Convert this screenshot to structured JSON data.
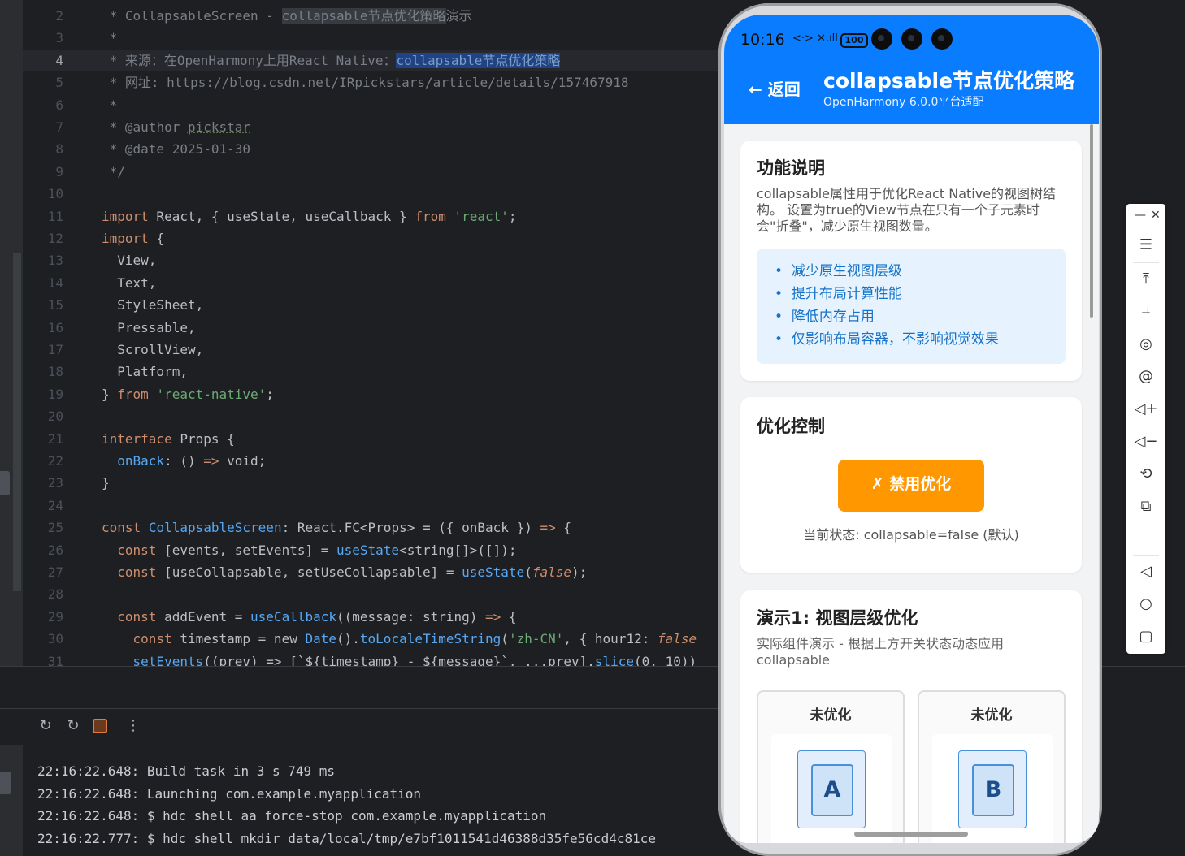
{
  "editor": {
    "lines": [
      {
        "n": "2",
        "parts": [
          {
            "t": " * CollapsableScreen - ",
            "c": "c-com"
          },
          {
            "t": "collapsable节点优化策略",
            "c": "c-hl2"
          },
          {
            "t": "演示",
            "c": "c-com"
          }
        ]
      },
      {
        "n": "3",
        "parts": [
          {
            "t": " *",
            "c": "c-com"
          }
        ]
      },
      {
        "n": "4",
        "current": true,
        "parts": [
          {
            "t": " * 来源：在OpenHarmony上用React Native：",
            "c": "c-com"
          },
          {
            "t": "collapsable节点优化策略",
            "c": "c-hl"
          }
        ]
      },
      {
        "n": "5",
        "parts": [
          {
            "t": " * 网址: https://blog.csdn.net/IRpickstars/article/details/157467918",
            "c": "c-com"
          }
        ]
      },
      {
        "n": "6",
        "parts": [
          {
            "t": " *",
            "c": "c-com"
          }
        ]
      },
      {
        "n": "7",
        "parts": [
          {
            "t": " * ",
            "c": "c-com"
          },
          {
            "t": "@author",
            "c": "c-com"
          },
          {
            "t": " ",
            "c": "c-com"
          },
          {
            "t": "pickstar",
            "c": "c-com c-under"
          }
        ]
      },
      {
        "n": "8",
        "parts": [
          {
            "t": " * @date 2025-01-30",
            "c": "c-com"
          }
        ]
      },
      {
        "n": "9",
        "parts": [
          {
            "t": " */",
            "c": "c-com"
          }
        ]
      },
      {
        "n": "10",
        "parts": []
      },
      {
        "n": "11",
        "parts": [
          {
            "t": "import",
            "c": "c-kw"
          },
          {
            "t": " React, { useState, useCallback } ",
            "c": ""
          },
          {
            "t": "from",
            "c": "c-kw"
          },
          {
            "t": " ",
            "c": ""
          },
          {
            "t": "'react'",
            "c": "c-str"
          },
          {
            "t": ";",
            "c": ""
          }
        ]
      },
      {
        "n": "12",
        "parts": [
          {
            "t": "import",
            "c": "c-kw"
          },
          {
            "t": " {",
            "c": ""
          }
        ]
      },
      {
        "n": "13",
        "parts": [
          {
            "t": "  View,",
            "c": ""
          }
        ]
      },
      {
        "n": "14",
        "parts": [
          {
            "t": "  Text,",
            "c": ""
          }
        ]
      },
      {
        "n": "15",
        "parts": [
          {
            "t": "  StyleSheet,",
            "c": ""
          }
        ]
      },
      {
        "n": "16",
        "parts": [
          {
            "t": "  Pressable,",
            "c": ""
          }
        ]
      },
      {
        "n": "17",
        "parts": [
          {
            "t": "  ScrollView,",
            "c": ""
          }
        ]
      },
      {
        "n": "18",
        "parts": [
          {
            "t": "  Platform,",
            "c": ""
          }
        ]
      },
      {
        "n": "19",
        "parts": [
          {
            "t": "} ",
            "c": ""
          },
          {
            "t": "from",
            "c": "c-kw"
          },
          {
            "t": " ",
            "c": ""
          },
          {
            "t": "'react-native'",
            "c": "c-str"
          },
          {
            "t": ";",
            "c": ""
          }
        ]
      },
      {
        "n": "20",
        "parts": []
      },
      {
        "n": "21",
        "parts": [
          {
            "t": "interface",
            "c": "c-kw"
          },
          {
            "t": " Props {",
            "c": ""
          }
        ]
      },
      {
        "n": "22",
        "parts": [
          {
            "t": "  ",
            "c": ""
          },
          {
            "t": "onBack",
            "c": "c-fn"
          },
          {
            "t": ": () ",
            "c": ""
          },
          {
            "t": "=>",
            "c": "c-kw"
          },
          {
            "t": " void;",
            "c": ""
          }
        ]
      },
      {
        "n": "23",
        "parts": [
          {
            "t": "}",
            "c": ""
          }
        ]
      },
      {
        "n": "24",
        "parts": []
      },
      {
        "n": "25",
        "parts": [
          {
            "t": "const",
            "c": "c-kw"
          },
          {
            "t": " ",
            "c": ""
          },
          {
            "t": "CollapsableScreen",
            "c": "c-fn"
          },
          {
            "t": ": React.FC<Props> = ({ onBack }) ",
            "c": ""
          },
          {
            "t": "=>",
            "c": "c-kw"
          },
          {
            "t": " {",
            "c": ""
          }
        ]
      },
      {
        "n": "26",
        "parts": [
          {
            "t": "  ",
            "c": ""
          },
          {
            "t": "const",
            "c": "c-kw"
          },
          {
            "t": " [events, setEvents] = ",
            "c": ""
          },
          {
            "t": "useState",
            "c": "c-fn"
          },
          {
            "t": "<string[]>([]);",
            "c": ""
          }
        ]
      },
      {
        "n": "27",
        "parts": [
          {
            "t": "  ",
            "c": ""
          },
          {
            "t": "const",
            "c": "c-kw"
          },
          {
            "t": " [useCollapsable, setUseCollapsable] = ",
            "c": ""
          },
          {
            "t": "useState",
            "c": "c-fn"
          },
          {
            "t": "(",
            "c": ""
          },
          {
            "t": "false",
            "c": "c-ital"
          },
          {
            "t": ");",
            "c": ""
          }
        ]
      },
      {
        "n": "28",
        "parts": []
      },
      {
        "n": "29",
        "parts": [
          {
            "t": "  ",
            "c": ""
          },
          {
            "t": "const",
            "c": "c-kw"
          },
          {
            "t": " addEvent = ",
            "c": ""
          },
          {
            "t": "useCallback",
            "c": "c-fn"
          },
          {
            "t": "((message: string) ",
            "c": ""
          },
          {
            "t": "=>",
            "c": "c-kw"
          },
          {
            "t": " {",
            "c": ""
          }
        ]
      },
      {
        "n": "30",
        "parts": [
          {
            "t": "    ",
            "c": ""
          },
          {
            "t": "const",
            "c": "c-kw"
          },
          {
            "t": " timestamp = new ",
            "c": ""
          },
          {
            "t": "Date",
            "c": "c-fn"
          },
          {
            "t": "().",
            "c": ""
          },
          {
            "t": "toLocaleTimeString",
            "c": "c-fn"
          },
          {
            "t": "(",
            "c": ""
          },
          {
            "t": "'zh-CN'",
            "c": "c-str"
          },
          {
            "t": ", { hour12: ",
            "c": ""
          },
          {
            "t": "false",
            "c": "c-ital"
          }
        ]
      },
      {
        "n": "31",
        "parts": [
          {
            "t": "    ",
            "c": ""
          },
          {
            "t": "setEvents",
            "c": "c-fn"
          },
          {
            "t": "((prev) => [`${timestamp} - ${message}`, ...prev].",
            "c": ""
          },
          {
            "t": "slice",
            "c": "c-fn"
          },
          {
            "t": "(0, 10))",
            "c": ""
          }
        ]
      }
    ]
  },
  "console": {
    "lines": [
      "22:16:22.648: Build task in 3 s 749 ms",
      "22:16:22.648: Launching com.example.myapplication",
      "22:16:22.648: $ hdc shell aa force-stop com.example.myapplication",
      "22:16:22.777: $ hdc shell mkdir data/local/tmp/e7bf1011541d46388d35fe56cd4c81ce"
    ]
  },
  "run_toolbar": {
    "icons": [
      "rerun-icon",
      "rerun-failed-icon",
      "stop-icon",
      "more-icon"
    ]
  },
  "phone": {
    "status": {
      "time": "10:16",
      "battery": "100",
      "icons": "<·> ✕.ıll"
    },
    "header": {
      "back_label": "← 返回",
      "title": "collapsable节点优化策略",
      "subtitle": "OpenHarmony 6.0.0平台适配"
    },
    "card_features": {
      "title": "功能说明",
      "desc": "collapsable属性用于优化React Native的视图树结构。 设置为true的View节点在只有一个子元素时会\"折叠\"，减少原生视图数量。",
      "bullets": [
        "减少原生视图层级",
        "提升布局计算性能",
        "降低内存占用",
        "仅影响布局容器，不影响视觉效果"
      ]
    },
    "card_control": {
      "title": "优化控制",
      "button_label": "✗ 禁用优化",
      "state": "当前状态: collapsable=false (默认)"
    },
    "card_demo": {
      "title": "演示1: 视图层级优化",
      "desc": "实际组件演示 - 根据上方开关状态动态应用collapsable",
      "columns": [
        {
          "title": "未优化",
          "box": "A"
        },
        {
          "title": "未优化",
          "box": "B"
        }
      ]
    },
    "colors": {
      "accent": "#0a7cff",
      "warning": "#ff9800",
      "info_bg": "#e6f3fe"
    }
  },
  "side_toolbar": {
    "icons": [
      "minimize-icon",
      "close-icon",
      "menu-icon",
      "pin-top-icon",
      "crop-icon",
      "location-icon",
      "at-icon",
      "volume-up-icon",
      "volume-down-icon",
      "rotate-icon",
      "multi-screen-icon",
      "back-nav-icon",
      "home-nav-icon",
      "recent-nav-icon"
    ]
  }
}
